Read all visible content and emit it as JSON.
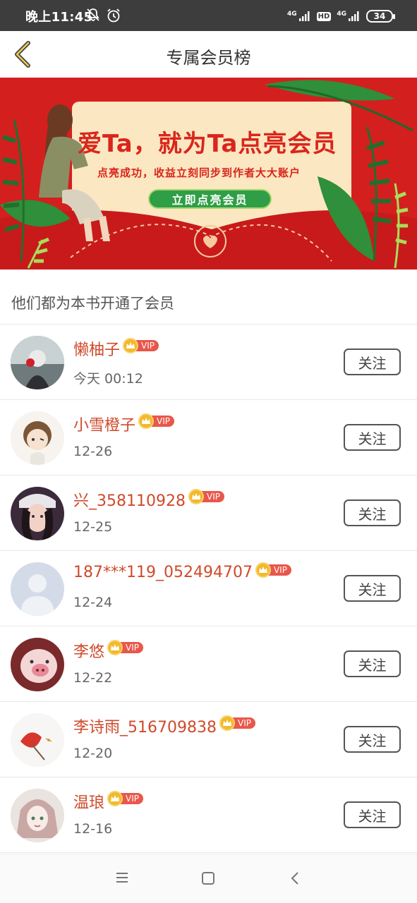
{
  "status_bar": {
    "time": "晚上11:45",
    "battery": "34",
    "network_1": "4G",
    "network_2": "4G",
    "hd": "HD"
  },
  "header": {
    "title": "专属会员榜"
  },
  "banner": {
    "headline": "爱Ta，就为Ta点亮会员",
    "subtitle": "点亮成功，收益立刻同步到作者大大账户",
    "button_label": "立即点亮会员"
  },
  "section_title": "他们都为本书开通了会员",
  "vip_label": "VIP",
  "follow_label": "关注",
  "members": [
    {
      "name": "懒柚子",
      "date": "今天 00:12"
    },
    {
      "name": "小雪橙子",
      "date": "12-26"
    },
    {
      "name": "兴_358110928",
      "date": "12-25"
    },
    {
      "name": "187***119_052494707",
      "date": "12-24"
    },
    {
      "name": "李悠",
      "date": "12-22"
    },
    {
      "name": "李诗雨_516709838",
      "date": "12-20"
    },
    {
      "name": "温琅",
      "date": "12-16"
    }
  ],
  "colors": {
    "accent_name": "#cf4a2b",
    "banner_red": "#d41f1f",
    "banner_button": "#2f9e46",
    "vip_tag": "#e9574b",
    "crown": "#f3b92a"
  }
}
